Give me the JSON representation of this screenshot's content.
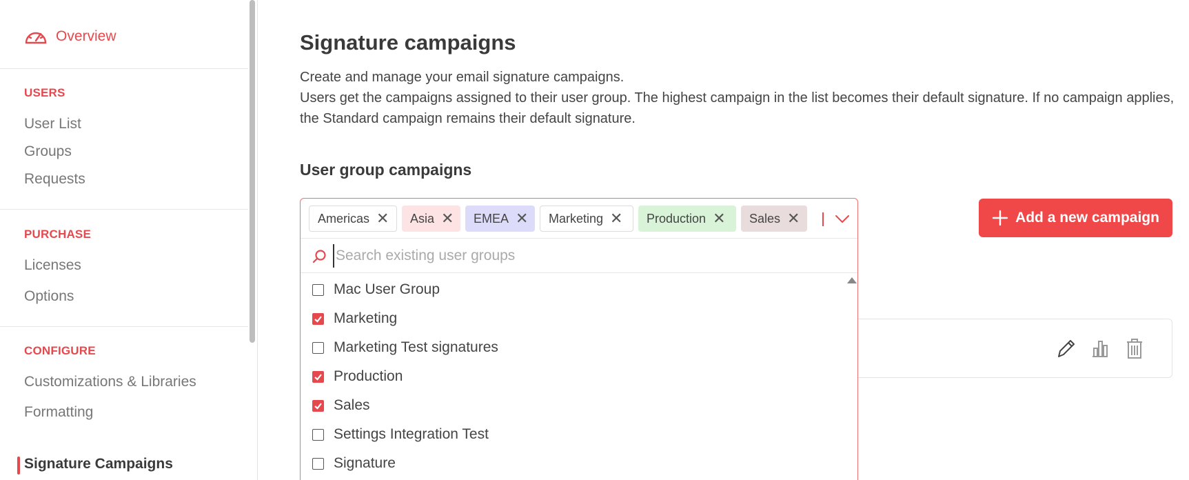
{
  "sidebar": {
    "overview": "Overview",
    "sections": [
      {
        "title": "USERS",
        "items": [
          "User List",
          "Groups",
          "Requests"
        ]
      },
      {
        "title": "PURCHASE",
        "items": [
          "Licenses",
          "Options"
        ]
      },
      {
        "title": "CONFIGURE",
        "items": [
          "Customizations & Libraries",
          "Formatting",
          "Signature Campaigns"
        ]
      }
    ],
    "active_item": "Signature Campaigns"
  },
  "main": {
    "title": "Signature campaigns",
    "description_line1": "Create and manage your email signature campaigns.",
    "description_line2": "Users get the campaigns assigned to their user group. The highest campaign in the list becomes their default signature. If no campaign applies, the Standard campaign remains their default signature.",
    "subtitle": "User group campaigns",
    "add_button": "Add a new campaign"
  },
  "multiselect": {
    "selected_tags": [
      "Americas",
      "Asia",
      "EMEA",
      "Marketing",
      "Production",
      "Sales"
    ],
    "search_placeholder": "Search existing user groups",
    "options": [
      {
        "label": "Mac User Group",
        "checked": false
      },
      {
        "label": "Marketing",
        "checked": true
      },
      {
        "label": "Marketing Test signatures",
        "checked": false
      },
      {
        "label": "Production",
        "checked": true
      },
      {
        "label": "Sales",
        "checked": true
      },
      {
        "label": "Settings Integration Test",
        "checked": false
      },
      {
        "label": "Signature",
        "checked": false
      }
    ]
  },
  "colors": {
    "accent": "#e5484d",
    "button": "#f04848"
  },
  "icons": {
    "overview": "speedometer-icon",
    "search": "search-icon",
    "dropdown": "chevron-down-icon",
    "edit": "pencil-icon",
    "stats": "bar-chart-icon",
    "delete": "trash-icon",
    "add": "plus-icon"
  }
}
